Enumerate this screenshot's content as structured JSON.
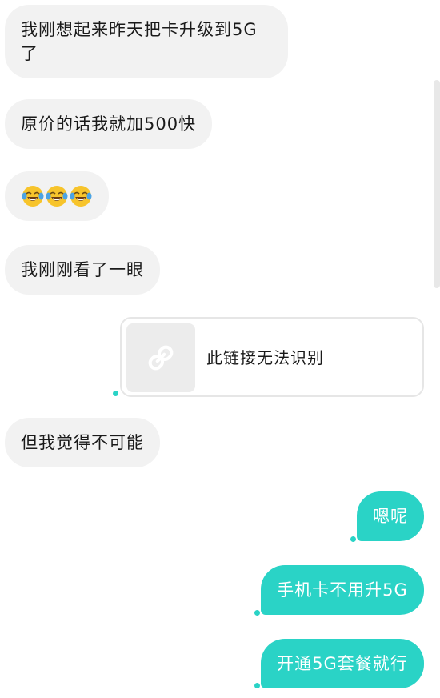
{
  "chat": {
    "incoming": [
      {
        "text": "我刚想起来昨天把卡升级到5G了"
      },
      {
        "text": "原价的话我就加500快"
      },
      {
        "emoji": [
          "face-with-tears-of-joy",
          "face-with-tears-of-joy",
          "face-with-tears-of-joy"
        ]
      },
      {
        "text": "我刚刚看了一眼"
      },
      {
        "text": "但我觉得不可能"
      }
    ],
    "link_card": {
      "icon": "link-icon",
      "text": "此链接无法识别"
    },
    "outgoing": [
      {
        "text": "嗯呢"
      },
      {
        "text": "手机卡不用升5G"
      },
      {
        "text": "开通5G套餐就行"
      }
    ]
  },
  "colors": {
    "incoming_bubble": "#f2f2f2",
    "outgoing_bubble": "#2ad3c6",
    "status_dot": "#2ad3c6"
  }
}
